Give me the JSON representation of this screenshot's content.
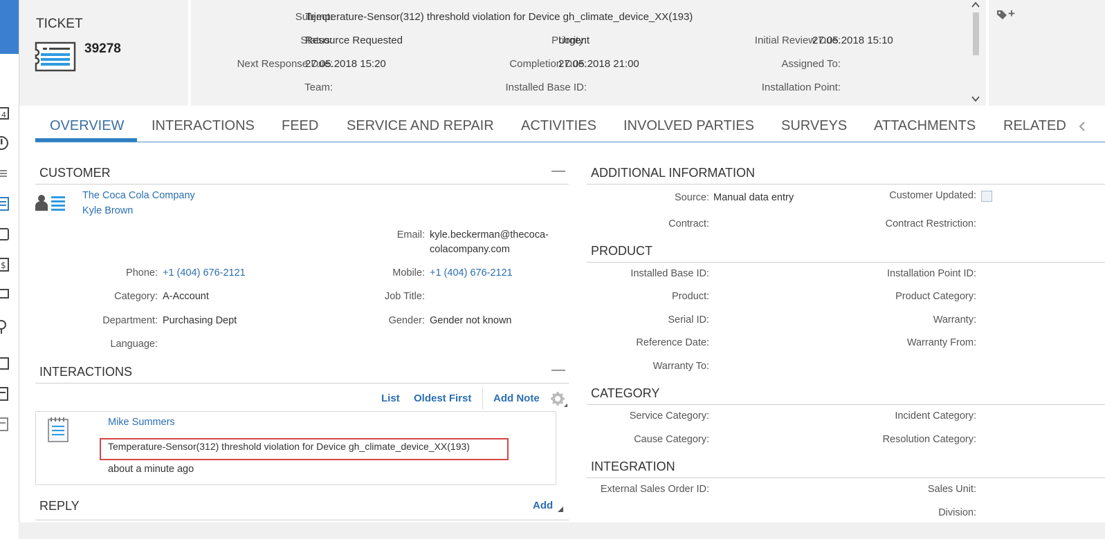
{
  "header": {
    "ticket_label": "TICKET",
    "ticket_number": "39278",
    "fields": {
      "subject_label": "Subject:",
      "subject_value": "Temperature-Sensor(312) threshold violation for Device gh_climate_device_XX(193)",
      "status_label": "Status:",
      "status_value": "Resource Requested",
      "priority_label": "Priority:",
      "priority_value": "Urgent",
      "initial_review_label": "Initial Review Due:",
      "initial_review_value": "27.05.2018 15:10",
      "next_response_label": "Next Response Due:",
      "next_response_value": "27.05.2018 15:20",
      "completion_label": "Completion Due:",
      "completion_value": "27.05.2018 21:00",
      "assigned_label": "Assigned To:",
      "team_label": "Team:",
      "installed_base_label": "Installed Base ID:",
      "installation_point_label": "Installation Point:"
    },
    "tag_add": "+"
  },
  "tabs": [
    "OVERVIEW",
    "INTERACTIONS",
    "FEED",
    "SERVICE AND REPAIR",
    "ACTIVITIES",
    "INVOLVED PARTIES",
    "SURVEYS",
    "ATTACHMENTS",
    "RELATED"
  ],
  "customer": {
    "title": "CUSTOMER",
    "collapse": "—",
    "company": "The Coca Cola Company",
    "contact": "Kyle Brown",
    "email_label": "Email:",
    "email_value_line1": "kyle.beckerman@thecoca-",
    "email_value_line2": "colacompany.com",
    "phone_label": "Phone:",
    "phone_value": "+1 (404) 676-2121",
    "mobile_label": "Mobile:",
    "mobile_value": "+1 (404) 676-2121",
    "category_label": "Category:",
    "category_value": "A-Account",
    "job_title_label": "Job Title:",
    "department_label": "Department:",
    "department_value": "Purchasing Dept",
    "gender_label": "Gender:",
    "gender_value": "Gender not known",
    "language_label": "Language:"
  },
  "interactions": {
    "title": "INTERACTIONS",
    "collapse": "—",
    "list_label": "List",
    "oldest_first_label": "Oldest First",
    "add_note_label": "Add Note",
    "item": {
      "author": "Mike Summers",
      "text": "Temperature-Sensor(312) threshold violation for Device gh_climate_device_XX(193)",
      "time": "about a minute ago"
    }
  },
  "reply": {
    "title": "REPLY",
    "add_label": "Add"
  },
  "additional_info": {
    "title": "ADDITIONAL INFORMATION",
    "source_label": "Source:",
    "source_value": "Manual data entry",
    "customer_updated_label": "Customer Updated:",
    "contract_label": "Contract:",
    "contract_restriction_label": "Contract Restriction:"
  },
  "product": {
    "title": "PRODUCT",
    "installed_base_label": "Installed Base ID:",
    "installation_point_label": "Installation Point ID:",
    "product_label": "Product:",
    "product_category_label": "Product Category:",
    "serial_label": "Serial ID:",
    "warranty_label": "Warranty:",
    "reference_date_label": "Reference Date:",
    "warranty_from_label": "Warranty From:",
    "warranty_to_label": "Warranty To:"
  },
  "category": {
    "title": "CATEGORY",
    "service_label": "Service Category:",
    "incident_label": "Incident Category:",
    "cause_label": "Cause Category:",
    "resolution_label": "Resolution Category:"
  },
  "integration": {
    "title": "INTEGRATION",
    "external_sales_label": "External Sales Order ID:",
    "sales_unit_label": "Sales Unit:",
    "division_label": "Division:"
  },
  "colors": {
    "accent": "#2f7fc2",
    "link": "#2b6fb2",
    "highlight": "#d64545",
    "header_bg": "#f2f2f2"
  }
}
